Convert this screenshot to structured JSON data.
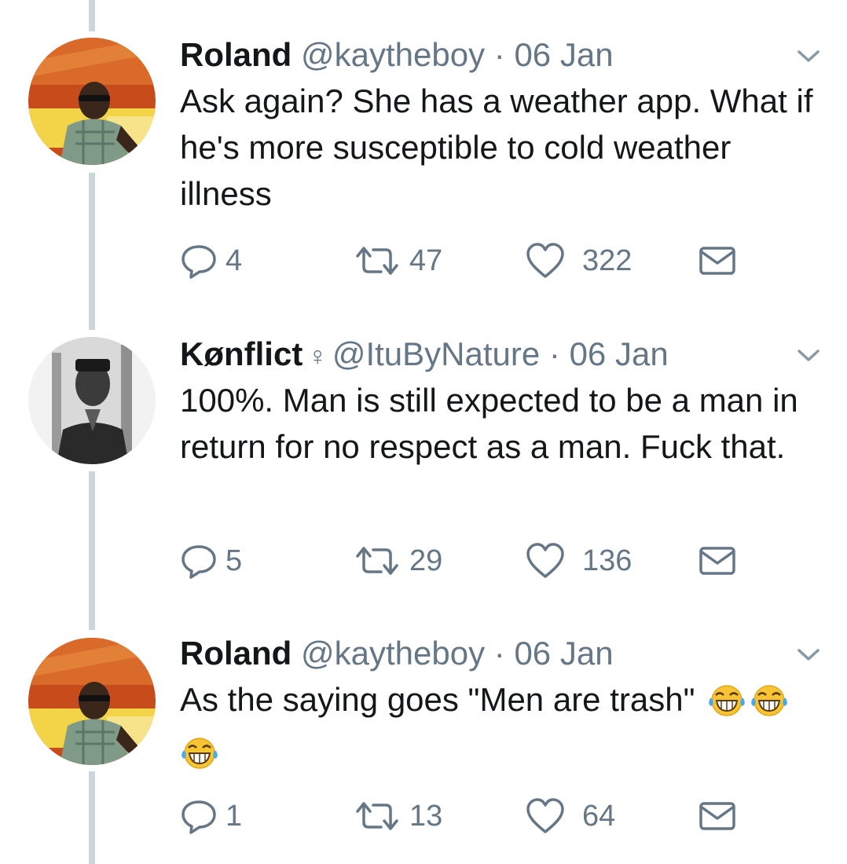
{
  "colors": {
    "text": "#14171a",
    "secondary": "#657786",
    "thread_line": "#ccd6dd",
    "icon": "#657786"
  },
  "tweets": [
    {
      "name": "Roland",
      "handle": "@kaytheboy",
      "separator": "·",
      "date": "06 Jan",
      "text": "Ask again? She has a weather app. What if he's more susceptible to cold weather illness",
      "emojis": [],
      "replies": "4",
      "retweets": "47",
      "likes": "322",
      "avatar": "profile-photo-man-sunglasses"
    },
    {
      "name": "Kønflict",
      "gender_symbol": "♀",
      "handle": "@ItuByNature",
      "separator": "·",
      "date": "06 Jan",
      "text": "100%. Man is still expected to be a man in return for no respect as a man. Fuck that.",
      "emojis": [],
      "replies": "5",
      "retweets": "29",
      "likes": "136",
      "avatar": "profile-photo-man-grayscale"
    },
    {
      "name": "Roland",
      "handle": "@kaytheboy",
      "separator": "·",
      "date": "06 Jan",
      "text": "As the saying goes \"Men are trash\"",
      "emojis": [
        "tears-of-joy",
        "tears-of-joy",
        "tears-of-joy"
      ],
      "replies": "1",
      "retweets": "13",
      "likes": "64",
      "avatar": "profile-photo-man-sunglasses"
    }
  ]
}
